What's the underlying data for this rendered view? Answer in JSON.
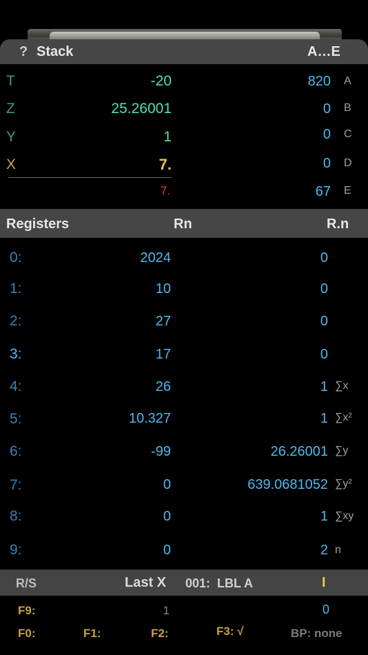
{
  "stack_header": {
    "help_icon": "?",
    "title": "Stack",
    "right_title": "A…E"
  },
  "stack": [
    {
      "label": "T",
      "value": "-20"
    },
    {
      "label": "Z",
      "value": "25.26001"
    },
    {
      "label": "Y",
      "value": "1"
    },
    {
      "label": "X",
      "value": "7."
    }
  ],
  "stack_input": "7.",
  "letter_registers": [
    {
      "label": "A",
      "value": "820"
    },
    {
      "label": "B",
      "value": "0"
    },
    {
      "label": "C",
      "value": "0"
    },
    {
      "label": "D",
      "value": "0"
    },
    {
      "label": "E",
      "value": "67"
    }
  ],
  "registers_header": {
    "title": "Registers",
    "col_rn": "Rn",
    "col_rdotn": "R.n"
  },
  "registers": [
    {
      "label": "0:",
      "rn": "2024",
      "rdn": "0",
      "stat": ""
    },
    {
      "label": "1:",
      "rn": "10",
      "rdn": "0",
      "stat": ""
    },
    {
      "label": "2:",
      "rn": "27",
      "rdn": "0",
      "stat": ""
    },
    {
      "label": "3:",
      "rn": "17",
      "rdn": "0",
      "stat": ""
    },
    {
      "label": "4:",
      "rn": "26",
      "rdn": "1",
      "stat": "∑x"
    },
    {
      "label": "5:",
      "rn": "10.327",
      "rdn": "1",
      "stat": "∑x²"
    },
    {
      "label": "6:",
      "rn": "-99",
      "rdn": "26.26001",
      "stat": "∑y"
    },
    {
      "label": "7:",
      "rn": "0",
      "rdn": "639.0681052",
      "stat": "∑y²"
    },
    {
      "label": "8:",
      "rn": "0",
      "rdn": "1",
      "stat": "∑xy"
    },
    {
      "label": "9:",
      "rn": "0",
      "rdn": "2",
      "stat": "n"
    }
  ],
  "program_bar": {
    "rs": "R/S",
    "last_x": "Last X",
    "line": "001:  LBL A",
    "cursor": "I"
  },
  "f9": {
    "label": "F9:",
    "mid": "1",
    "value": "0"
  },
  "fkeys": {
    "f0": "F0:",
    "f1": "F1:",
    "f2": "F2:",
    "f3": "F3: √",
    "bp": "BP: none"
  },
  "colors": {
    "teal": "#4fe0b8",
    "gold": "#f0c050",
    "blue": "#4fb8ee",
    "red": "#e23a3a",
    "bar": "#464646"
  }
}
